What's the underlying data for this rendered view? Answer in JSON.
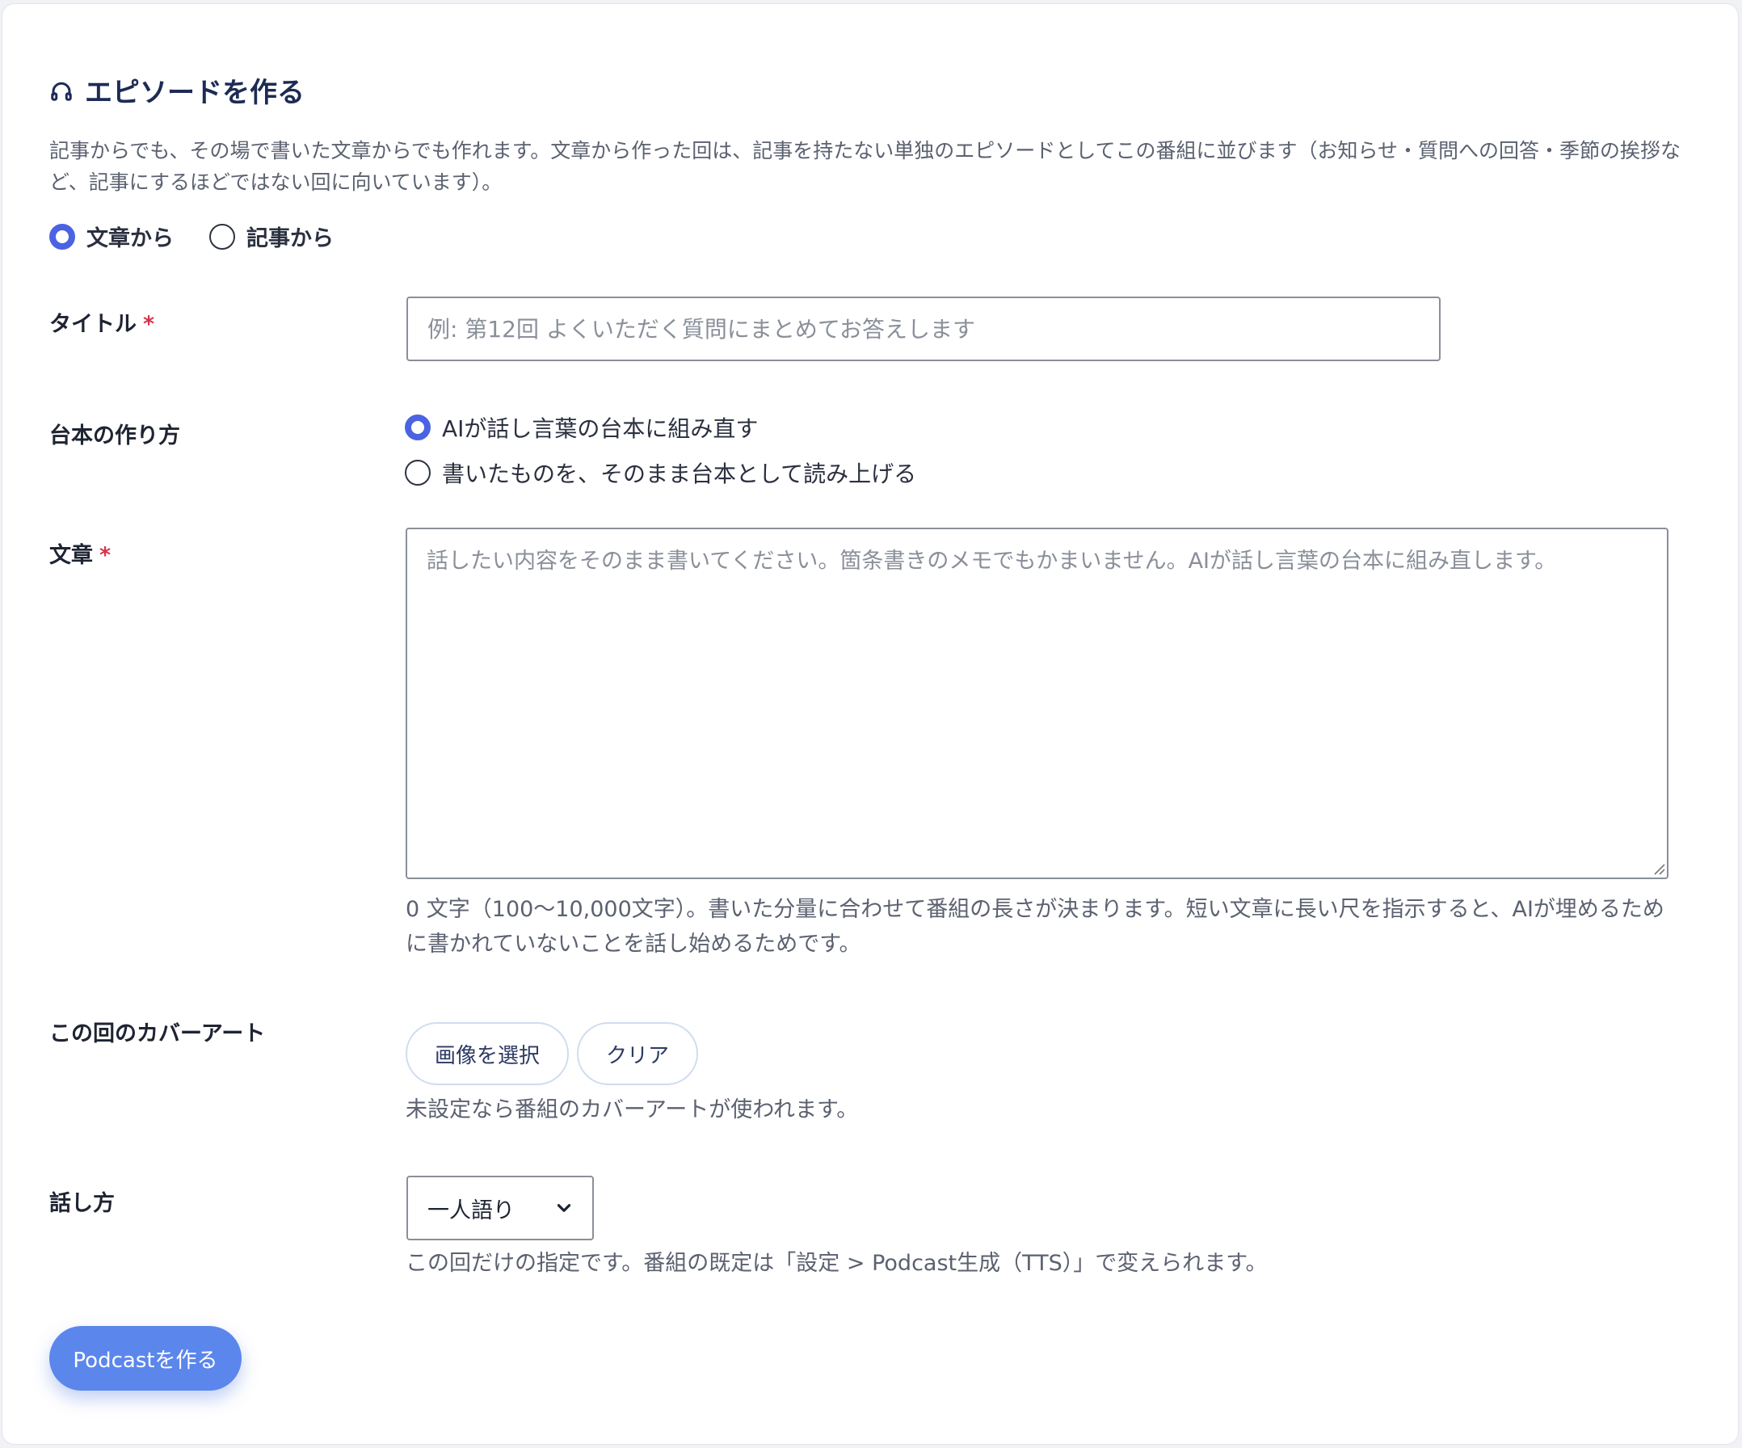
{
  "colors": {
    "accent": "#4b63e3",
    "submit": "#5b86ec",
    "heading": "#1d2b55",
    "required": "#d6334a"
  },
  "header": {
    "icon": "headphones-icon",
    "title": "エピソードを作る"
  },
  "intro_text": "記事からでも、その場で書いた文章からでも作れます。文章から作った回は、記事を持たない単独のエピソードとしてこの番組に並びます（お知らせ・質問への回答・季節の挨拶など、記事にするほどではない回に向いています）。",
  "source_mode": {
    "selected": "text",
    "options": [
      {
        "id": "text",
        "label": "文章から"
      },
      {
        "id": "article",
        "label": "記事から"
      }
    ]
  },
  "title_field": {
    "label": "タイトル",
    "required_mark": "*",
    "value": "",
    "placeholder": "例: 第12回 よくいただく質問にまとめてお答えします"
  },
  "script_method": {
    "label": "台本の作り方",
    "selected": "rewrite",
    "options": [
      {
        "id": "rewrite",
        "label": "AIが話し言葉の台本に組み直す"
      },
      {
        "id": "read",
        "label": "書いたものを、そのまま台本として読み上げる"
      }
    ]
  },
  "body_field": {
    "label": "文章",
    "required_mark": "*",
    "value": "",
    "placeholder": "話したい内容をそのまま書いてください。箇条書きのメモでもかまいません。AIが話し言葉の台本に組み直します。",
    "help": "0 文字（100〜10,000文字）。書いた分量に合わせて番組の長さが決まります。短い文章に長い尺を指示すると、AIが埋めるために書かれていないことを話し始めるためです。"
  },
  "cover_art": {
    "label": "この回のカバーアート",
    "select_button": "画像を選択",
    "clear_button": "クリア",
    "help": "未設定なら番組のカバーアートが使われます。"
  },
  "speaking_style": {
    "label": "話し方",
    "selected": "一人語り",
    "help": "この回だけの指定です。番組の既定は「設定 > Podcast生成（TTS）」で変えられます。"
  },
  "submit_label": "Podcastを作る"
}
